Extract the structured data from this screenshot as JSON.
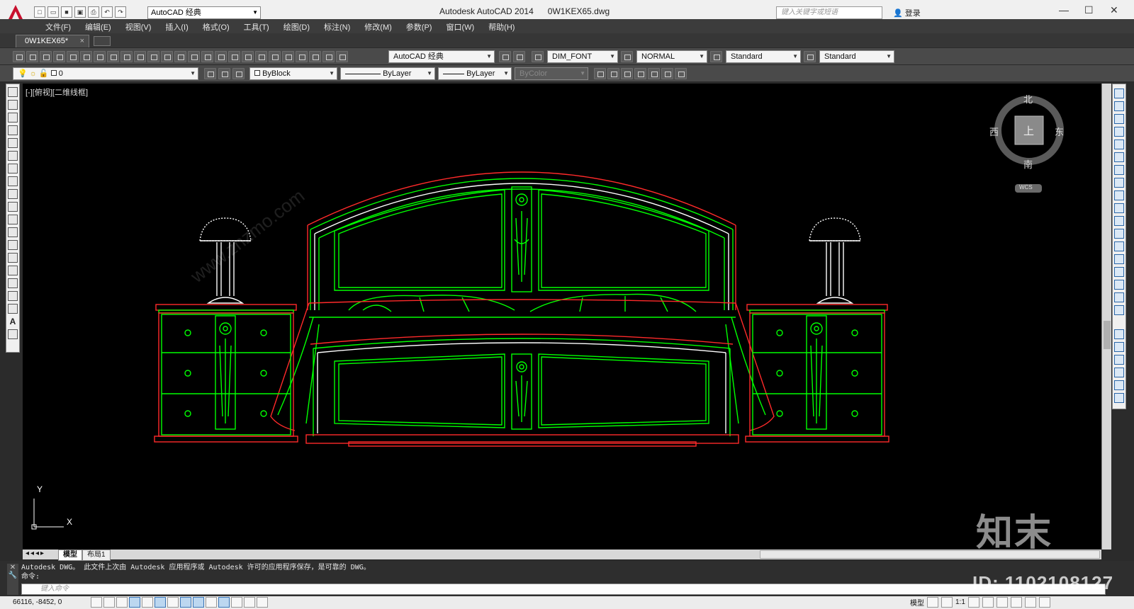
{
  "window": {
    "title": "Autodesk AutoCAD 2014",
    "file_name": "0W1KEX65.dwg",
    "workspace": "AutoCAD 经典",
    "search_placeholder": "键入关键字或短语",
    "signin_label": "登录"
  },
  "menubar": {
    "items": [
      "文件(F)",
      "编辑(E)",
      "视图(V)",
      "插入(I)",
      "格式(O)",
      "工具(T)",
      "绘图(D)",
      "标注(N)",
      "修改(M)",
      "参数(P)",
      "窗口(W)",
      "帮助(H)"
    ]
  },
  "document_tab": {
    "label": "0W1KEX65*"
  },
  "toolbar1": {
    "workspace_select": "AutoCAD 经典",
    "text_style": "DIM_FONT",
    "dim_style": "NORMAL",
    "table_style": "Standard",
    "multileader_style": "Standard"
  },
  "toolbar2": {
    "layer": "0",
    "color": "ByBlock",
    "linetype": "ByLayer",
    "lineweight": "ByLayer",
    "plot_style": "ByColor"
  },
  "viewport": {
    "label": "[-][俯视][二维线框]"
  },
  "viewcube": {
    "north": "北",
    "south": "南",
    "east": "东",
    "west": "西",
    "face": "上",
    "wcs": "WCS"
  },
  "ucs": {
    "x_label": "X",
    "y_label": "Y"
  },
  "layout_tabs": {
    "model": "模型",
    "layout1": "布局1"
  },
  "command": {
    "history_line1": "Autodesk DWG。  此文件上次由 Autodesk 应用程序或 Autodesk 许可的应用程序保存，是可靠的 DWG。",
    "history_line2": "命令:",
    "input_placeholder": "键入命令"
  },
  "statusbar": {
    "coordinates": "66116, -8452, 0",
    "model_label": "模型",
    "scale": "1:1"
  },
  "watermark": {
    "brand": "知末",
    "id_text": "ID: 1102108127",
    "site": "www.znzmo.com"
  },
  "colors": {
    "drawing_bg": "#000000",
    "line_green": "#00ff00",
    "line_red": "#ff2a2a",
    "line_white": "#ffffff",
    "autocad_red": "#c8102e"
  }
}
